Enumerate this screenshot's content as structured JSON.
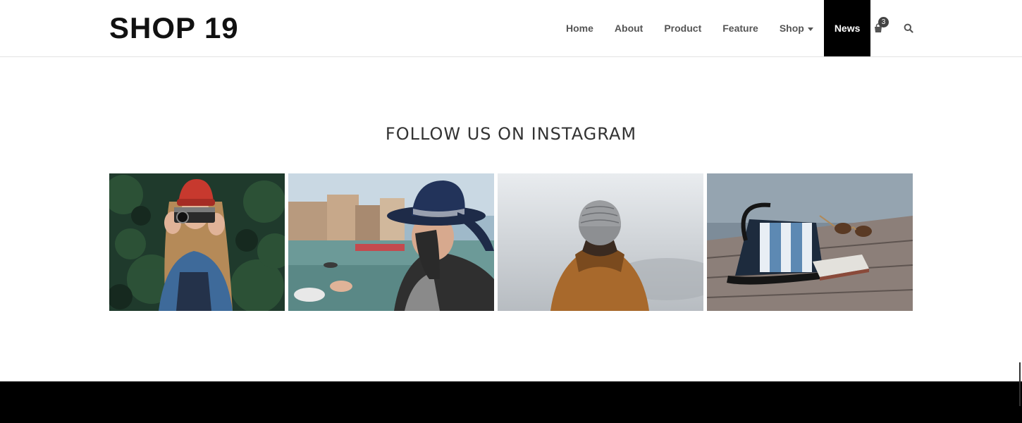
{
  "header": {
    "logo": "SHOP 19",
    "nav": [
      {
        "label": "Home"
      },
      {
        "label": "About"
      },
      {
        "label": "Product"
      },
      {
        "label": "Feature"
      },
      {
        "label": "Shop",
        "has_dropdown": true
      },
      {
        "label": "News",
        "active": true
      }
    ],
    "cart": {
      "icon": "shopping-bag-icon",
      "count": "3"
    },
    "search": {
      "icon": "search-icon"
    }
  },
  "instagram": {
    "title": "FOLLOW US ON INSTAGRAM",
    "photos": [
      {
        "subject": "woman-with-camera-red-beanie"
      },
      {
        "subject": "woman-in-hat-venice-canal"
      },
      {
        "subject": "person-in-beanie-fog"
      },
      {
        "subject": "bag-and-sunglasses-on-dock"
      }
    ]
  },
  "colors": {
    "active_nav_bg": "#000000",
    "footer_bg": "#000000",
    "nav_text": "#555555"
  }
}
